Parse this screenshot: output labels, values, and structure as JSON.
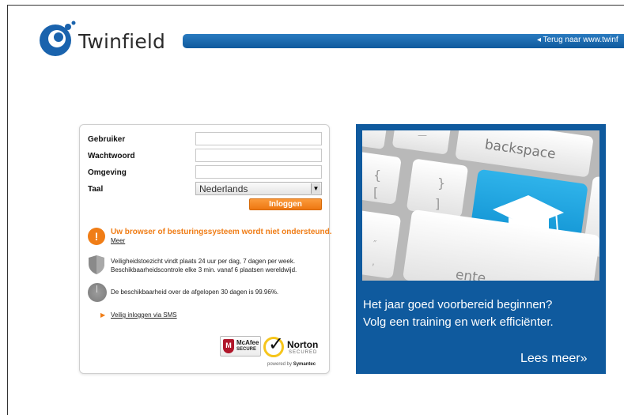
{
  "brand": {
    "logo_text": "Twinfield",
    "blue": "#0f5a9e",
    "orange": "#f07d16"
  },
  "topbar": {
    "back_link": "◂ Terug naar www.twinf"
  },
  "login": {
    "fields": {
      "user": {
        "label": "Gebruiker",
        "value": ""
      },
      "password": {
        "label": "Wachtwoord",
        "value": ""
      },
      "environment": {
        "label": "Omgeving",
        "value": ""
      },
      "language": {
        "label": "Taal",
        "selected": "Nederlands"
      }
    },
    "login_button": "Inloggen",
    "warning": {
      "text": "Uw browser of besturingssysteem wordt niet ondersteund.",
      "link": "Meer"
    },
    "security": {
      "line1": "Veiligheidstoezicht vindt plaats 24 uur per dag, 7 dagen per week.",
      "line2": "Beschikbaarheidscontrole elke 3 min. vanaf 6 plaatsen wereldwijd."
    },
    "availability": "De beschikbaarheid over de afgelopen 30 dagen is 99.96%.",
    "sms_link": "Veilig inloggen via SMS",
    "badges": {
      "mcafee_line1": "McAfee",
      "mcafee_line2": "SECURE",
      "norton_line1": "Norton",
      "norton_line2": "SECURED",
      "powered_prefix": "powered by",
      "powered_brand": "Symantec"
    }
  },
  "promo": {
    "keys": {
      "backspace": "backspace",
      "enter": "ente"
    },
    "title_line1": "Het jaar goed voorbereid beginnen?",
    "title_line2": "Volg een training en werk efficiënter.",
    "more_link": "Lees meer»"
  }
}
